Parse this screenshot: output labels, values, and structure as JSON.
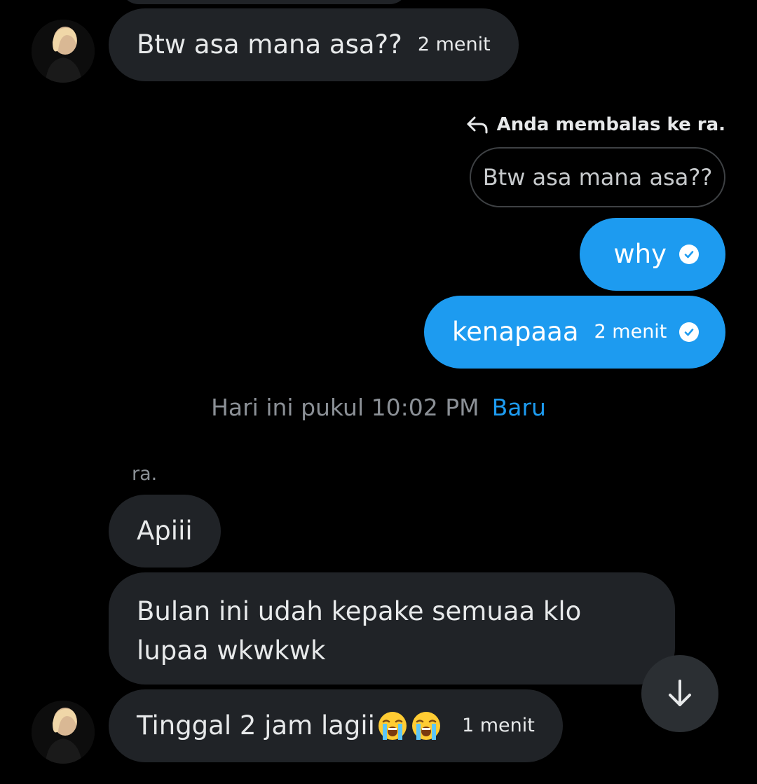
{
  "messages": {
    "m1_text": "Btw asa mana asa??",
    "m1_time": "2 menit",
    "reply_label": "Anda membalas ke ra.",
    "quoted_text": "Btw asa mana asa??",
    "m2_text": "why",
    "m3_text": "kenapaaa",
    "m3_time": "2 menit",
    "timestamp": "Hari ini pukul 10:02 PM",
    "new_label": "Baru",
    "sender_name": "ra.",
    "m4_text": "Apiii",
    "m5_text": "Bulan ini udah kepake semuaa klo lupaa wkwkwk",
    "m6_text": "Tinggal 2 jam lagii",
    "m6_time": "1 menit"
  },
  "icons": {
    "reply": "reply-arrow-icon",
    "read": "check-circle-icon",
    "emoji": "loudly-crying-face-emoji",
    "scroll": "arrow-down-icon"
  },
  "colors": {
    "background": "#000000",
    "incoming_bubble": "#202327",
    "outgoing_bubble": "#1d9bf0",
    "muted_text": "#8b9096",
    "accent": "#1d9bf0"
  }
}
